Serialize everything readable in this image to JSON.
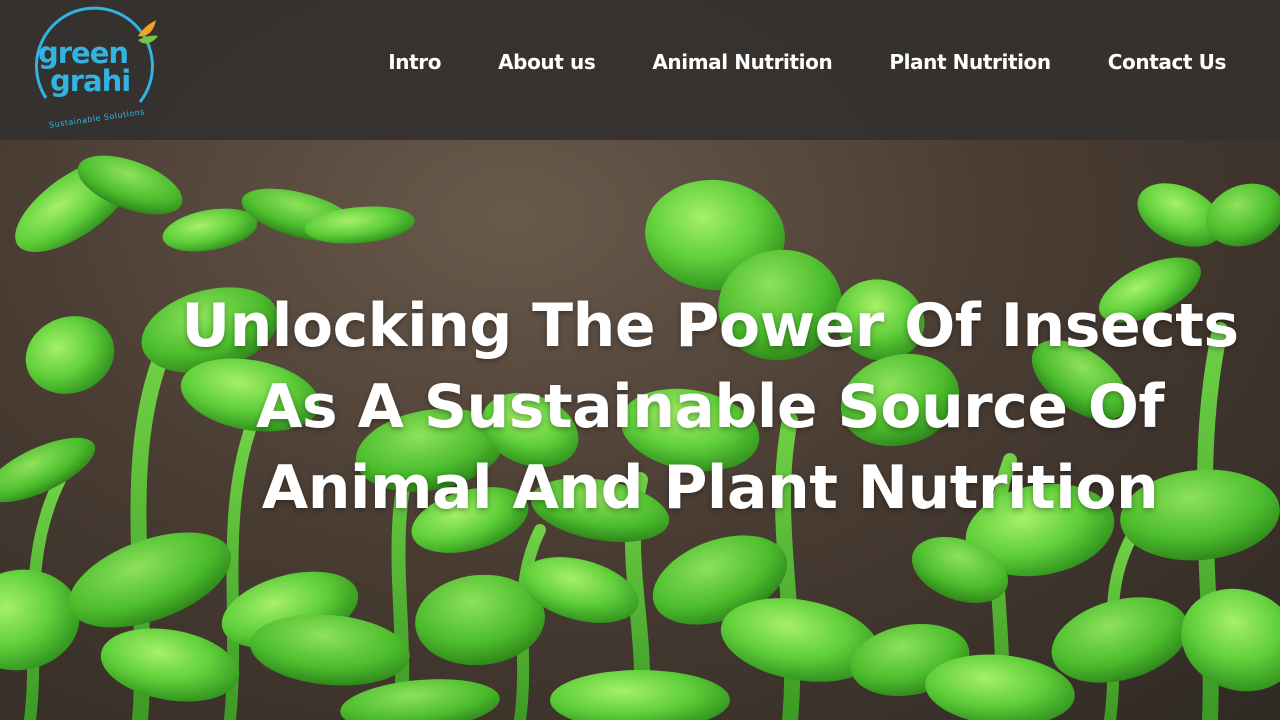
{
  "logo": {
    "line1": "green",
    "line2": "grahi",
    "tagline": "Sustainable  Solutions"
  },
  "nav": {
    "items": [
      {
        "label": "Intro"
      },
      {
        "label": "About us"
      },
      {
        "label": "Animal Nutrition"
      },
      {
        "label": "Plant Nutrition"
      },
      {
        "label": "Contact Us"
      }
    ]
  },
  "hero": {
    "headline_lines": [
      "Unlocking The Power Of Insects",
      "As A Sustainable Source Of",
      "Animal And Plant Nutrition"
    ]
  },
  "colors": {
    "header_bg": "#34302e",
    "logo_blue": "#33b3e4",
    "leaf_green": "#5fcf3a",
    "text": "#ffffff"
  }
}
